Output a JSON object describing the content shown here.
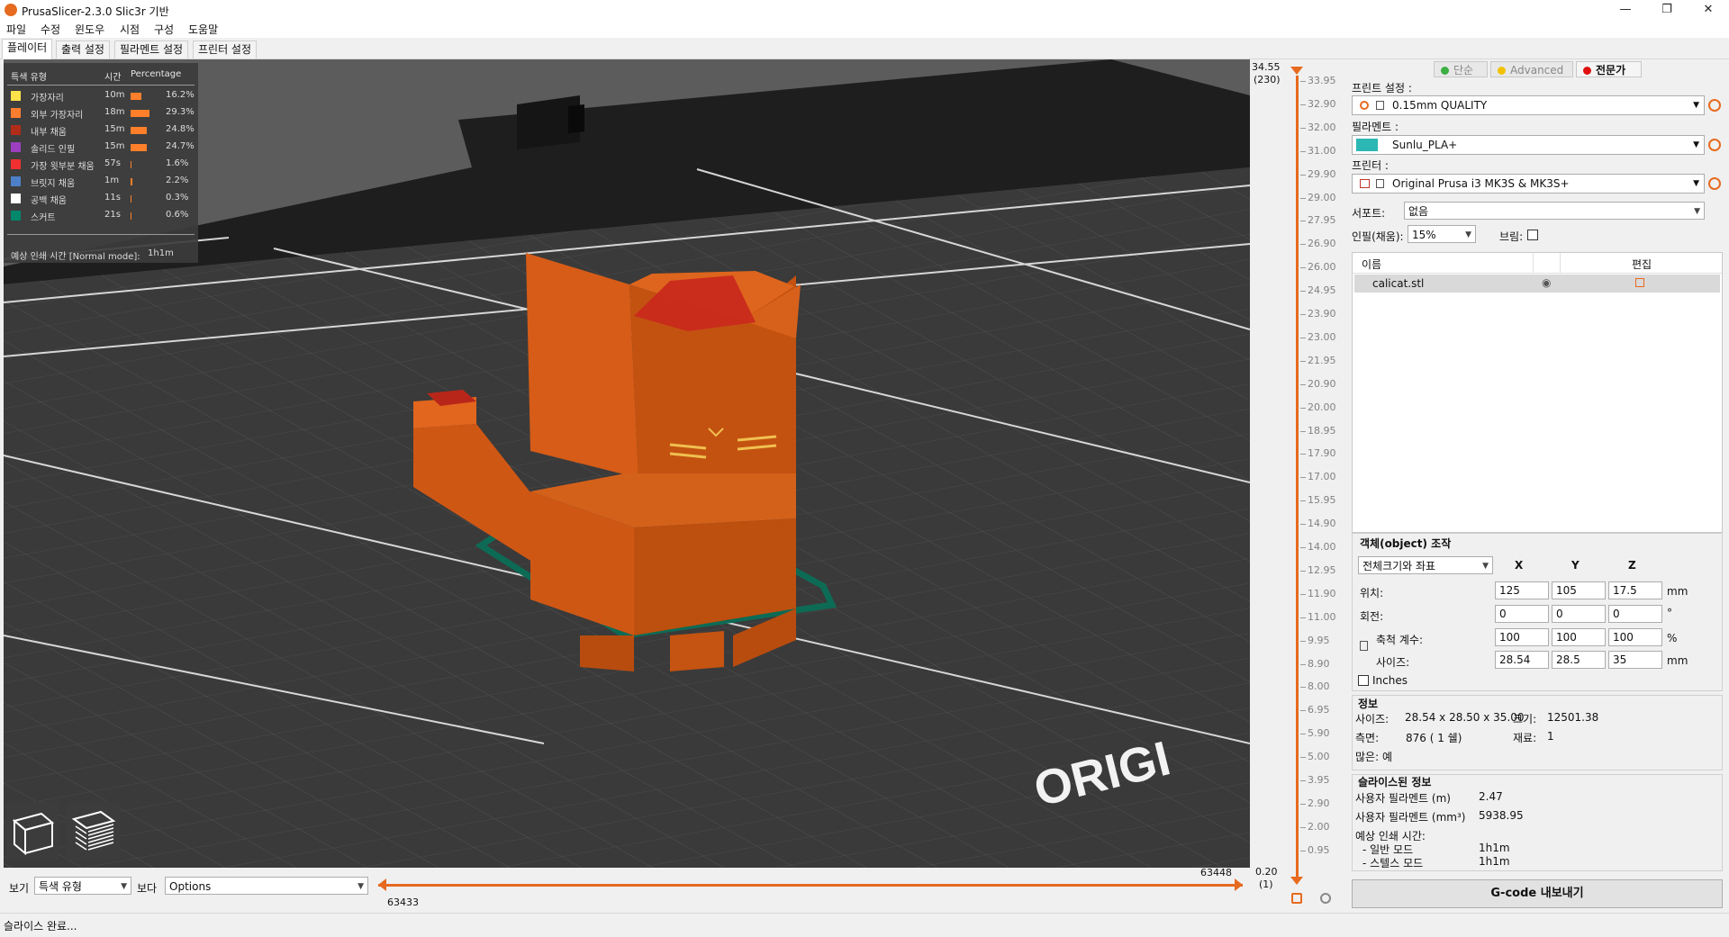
{
  "window": {
    "title": "PrusaSlicer-2.3.0 Slic3r 기반"
  },
  "menu": [
    "파일",
    "수정",
    "윈도우",
    "시점",
    "구성",
    "도움말"
  ],
  "tabs": [
    "플레이터",
    "출력 설정",
    "필라멘트 설정",
    "프린터 설정"
  ],
  "legend": {
    "headers": {
      "type": "특색 유형",
      "time": "시간",
      "percentage": "Percentage"
    },
    "rows": [
      {
        "name": "가장자리",
        "time": "10m",
        "percent": "16.2%",
        "value": 16.2,
        "color": "#ffe24a"
      },
      {
        "name": "외부 가장자리",
        "time": "18m",
        "percent": "29.3%",
        "value": 29.3,
        "color": "#ff7d2e"
      },
      {
        "name": "내부 채움",
        "time": "15m",
        "percent": "24.8%",
        "value": 24.8,
        "color": "#b22c1a"
      },
      {
        "name": "솔리드 인필",
        "time": "15m",
        "percent": "24.7%",
        "value": 24.7,
        "color": "#9b3fbf"
      },
      {
        "name": "가장 윗부분 채움",
        "time": "57s",
        "percent": "1.6%",
        "value": 1.6,
        "color": "#f03030"
      },
      {
        "name": "브릿지 채움",
        "time": "1m",
        "percent": "2.2%",
        "value": 2.2,
        "color": "#4d80c8"
      },
      {
        "name": "공백 채움",
        "time": "11s",
        "percent": "0.3%",
        "value": 0.3,
        "color": "#ffffff"
      },
      {
        "name": "스커트",
        "time": "21s",
        "percent": "0.6%",
        "value": 0.6,
        "color": "#00876c"
      }
    ],
    "estimate_label": "예상 인쇄 시간 [Normal mode]:",
    "estimate_value": "1h1m"
  },
  "viewport": {
    "bed_text": "ORIGI"
  },
  "bottom": {
    "view_label": "보기",
    "view_value": "특색 유형",
    "show_label": "보다",
    "show_value": "Options",
    "left_move": "63433",
    "right_move": "63448"
  },
  "layer_slider": {
    "top_value": "34.55",
    "top_layer": "(230)",
    "bottom_value": "0.20",
    "bottom_layer": "(1)",
    "ticks": [
      "33.95",
      "32.90",
      "32.00",
      "31.00",
      "29.90",
      "29.00",
      "27.95",
      "26.90",
      "26.00",
      "24.95",
      "23.90",
      "23.00",
      "21.95",
      "20.90",
      "20.00",
      "18.95",
      "17.90",
      "17.00",
      "15.95",
      "14.90",
      "14.00",
      "12.95",
      "11.90",
      "11.00",
      "9.95",
      "8.90",
      "8.00",
      "6.95",
      "5.90",
      "5.00",
      "3.95",
      "2.90",
      "2.00",
      "0.95"
    ]
  },
  "modes": [
    {
      "label": "단순",
      "color": "#3cb043"
    },
    {
      "label": "Advanced",
      "color": "#f2c200"
    },
    {
      "label": "전문가",
      "color": "#e01010"
    }
  ],
  "presets": {
    "print_label": "프린트 설정 :",
    "print_value": "0.15mm QUALITY",
    "filament_label": "필라멘트 :",
    "filament_value": "Sunlu_PLA+",
    "filament_color": "#2bb7b3",
    "printer_label": "프린터 :",
    "printer_value": "Original Prusa i3 MK3S & MK3S+",
    "support_label": "서포트:",
    "support_value": "없음",
    "infill_label": "인필(채움):",
    "infill_value": "15%",
    "brim_label": "브림:"
  },
  "object_list": {
    "col_name": "이름",
    "col_edit": "편집",
    "items": [
      {
        "name": "calicat.stl"
      }
    ]
  },
  "manipulation": {
    "title": "객체(object) 조작",
    "mode": "전체크기와 좌표",
    "axes": [
      "X",
      "Y",
      "Z"
    ],
    "rows": [
      {
        "label": "위치:",
        "values": [
          "125",
          "105",
          "17.5"
        ],
        "unit": "mm"
      },
      {
        "label": "회전:",
        "values": [
          "0",
          "0",
          "0"
        ],
        "unit": "°"
      },
      {
        "label": "축척 계수:",
        "values": [
          "100",
          "100",
          "100"
        ],
        "unit": "%"
      },
      {
        "label": "사이즈:",
        "values": [
          "28.54",
          "28.5",
          "35"
        ],
        "unit": "mm"
      }
    ],
    "inches_label": "Inches"
  },
  "info": {
    "title": "정보",
    "size_label": "사이즈:",
    "size_value": "28.54 x 28.50 x 35.00",
    "volume_label": "크기:",
    "volume_value": "12501.38",
    "facets_label": "측면:",
    "facets_value": "876 ( 1 쉘)",
    "materials_label": "재료:",
    "materials_value": "1",
    "manifold_label": "많은: 예"
  },
  "sliced": {
    "title": "슬라이스된 정보",
    "filament_m_label": "사용자 필라멘트 (m)",
    "filament_m_value": "2.47",
    "filament_mm3_label": "사용자 필라멘트 (mm³)",
    "filament_mm3_value": "5938.95",
    "est_label": "예상 인쇄 시간:",
    "normal_label": "- 일반 모드",
    "normal_value": "1h1m",
    "stealth_label": "- 스텔스 모드",
    "stealth_value": "1h1m"
  },
  "export_button": "G-code 내보내기",
  "status": "슬라이스 완료..."
}
